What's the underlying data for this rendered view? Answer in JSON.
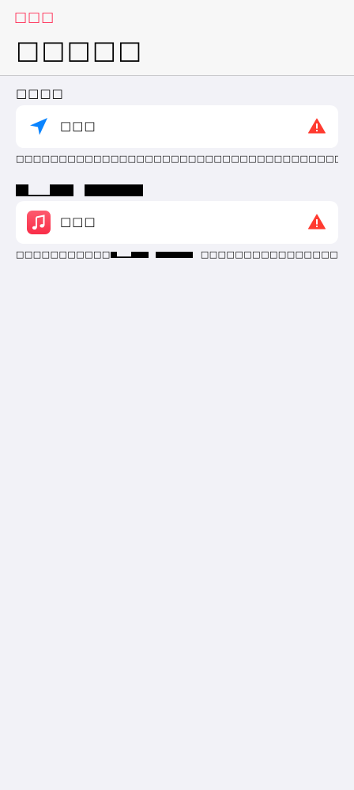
{
  "header": {
    "back_label": "□□□",
    "title": "□□□□□"
  },
  "sections": [
    {
      "header": "□□□□",
      "item": {
        "label": "□□□",
        "icon": "location-arrow-icon",
        "warning_icon": "warning-triangle-icon"
      },
      "footnote": "□□□□□□□□□□□□□□□□□□□□□□□□□□□□□□□□□□□□□□□□□□□□□□"
    },
    {
      "item": {
        "label": "□□□",
        "icon": "music-app-icon",
        "warning_icon": "warning-triangle-icon"
      },
      "footnote_start": "□□□□□□□□□□□",
      "footnote_end": "□□□□□□□□□□□□□□□□□□□□□□"
    }
  ],
  "colors": {
    "accent": "#ff2d55",
    "location_blue": "#0a84ff",
    "warning_red": "#ff3b30",
    "music_gradient_top": "#fd5a6e",
    "music_gradient_bottom": "#f92d48",
    "background": "#f2f2f7"
  }
}
